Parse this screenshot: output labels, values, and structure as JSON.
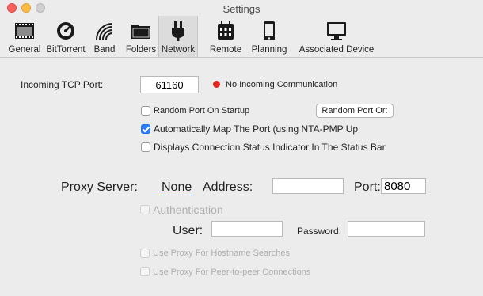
{
  "window": {
    "title": "Settings"
  },
  "toolbar": {
    "items": [
      {
        "label": "General",
        "icon": "general-icon"
      },
      {
        "label": "BitTorrent",
        "icon": "bittorrent-icon"
      },
      {
        "label": "Band",
        "icon": "bandwidth-icon"
      },
      {
        "label": "Folders",
        "icon": "folder-icon"
      },
      {
        "label": "Network",
        "icon": "plug-icon",
        "active": true
      },
      {
        "label": "Remote",
        "icon": "remote-icon"
      },
      {
        "label": "Planning",
        "icon": "calendar-icon"
      },
      {
        "label": "Associated Device",
        "icon": "monitor-icon"
      }
    ]
  },
  "network": {
    "incoming_port_label": "Incoming TCP Port:",
    "incoming_port_value": "61160",
    "status_text": "No Incoming Communication",
    "status_color": "#e0261f",
    "random_port_startup_label": "Random Port On Startup",
    "random_port_button": "Random Port Or:",
    "auto_map_label": "Automatically Map The Port (using NTA-PMP Up",
    "status_indicator_label": "Displays Connection Status Indicator In The Status Bar"
  },
  "proxy": {
    "server_label": "Proxy Server:",
    "server_value": "None",
    "address_label": "Address:",
    "address_value": "",
    "port_label": "Port:",
    "port_value": "8080",
    "auth_label": "Authentication",
    "user_label": "User:",
    "user_value": "",
    "password_label": "Password:",
    "password_value": "",
    "hostname_label": "Use Proxy For Hostname Searches",
    "p2p_label": "Use Proxy For Peer-to-peer Connections"
  },
  "colors": {
    "accent": "#2f7ef6"
  }
}
